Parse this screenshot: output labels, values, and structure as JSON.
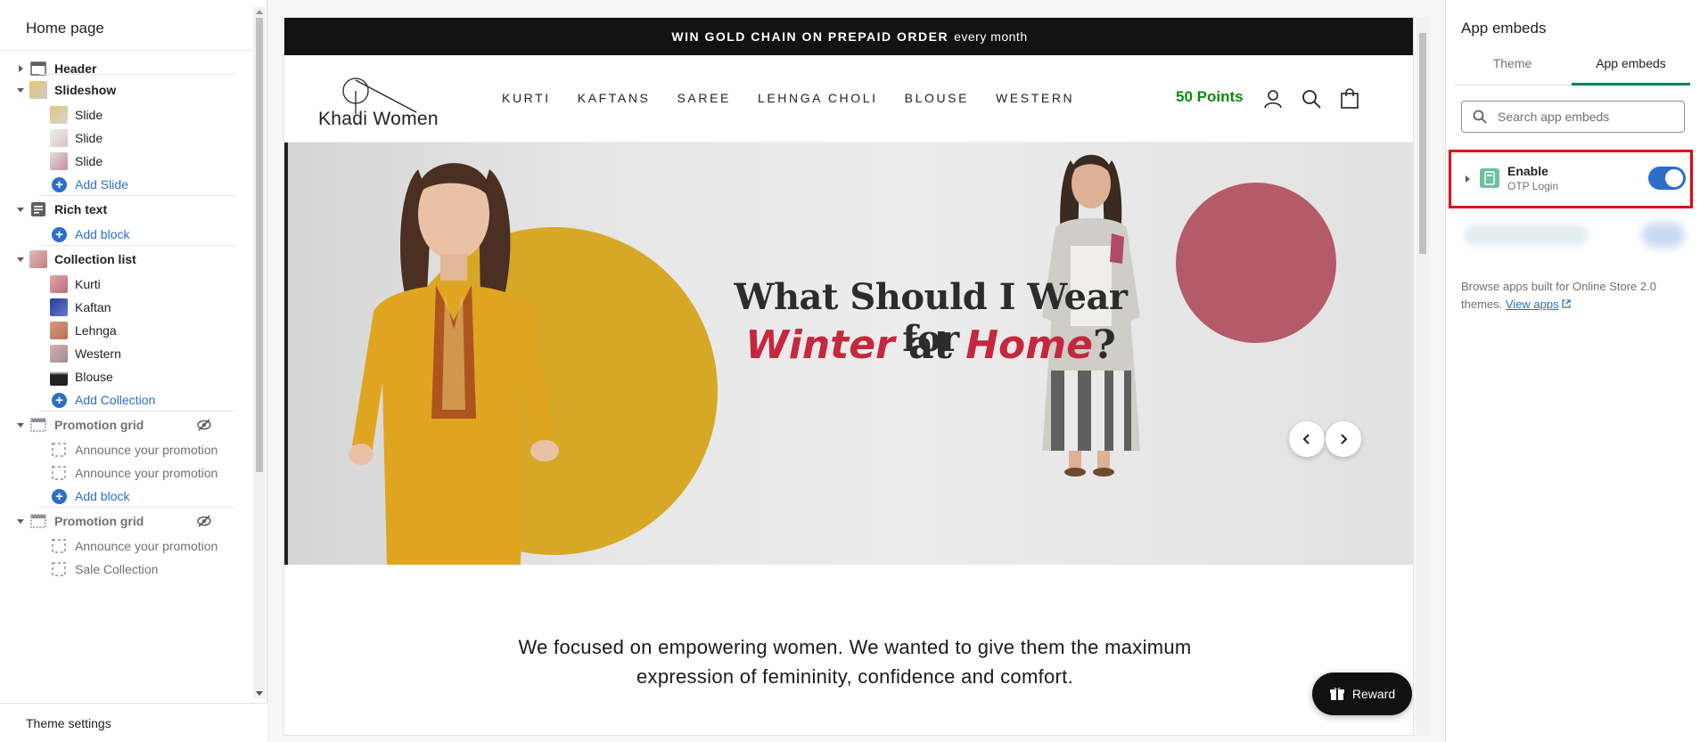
{
  "left_panel": {
    "title": "Home page",
    "sections": [
      {
        "label": "Header"
      },
      {
        "label": "Slideshow",
        "children": [
          "Slide",
          "Slide",
          "Slide"
        ],
        "add_label": "Add Slide"
      },
      {
        "label": "Rich text",
        "add_label": "Add block"
      },
      {
        "label": "Collection list",
        "children": [
          "Kurti",
          "Kaftan",
          "Lehnga",
          "Western",
          "Blouse"
        ],
        "add_label": "Add Collection"
      },
      {
        "label": "Promotion grid",
        "hidden": true,
        "children": [
          "Announce your promotion",
          "Announce your promotion"
        ],
        "add_label": "Add block"
      },
      {
        "label": "Promotion grid",
        "hidden": true,
        "children": [
          "Announce your promotion",
          "Sale Collection"
        ]
      }
    ],
    "footer_label": "Theme settings"
  },
  "preview": {
    "announcement_bold": "WIN GOLD CHAIN ON PREPAID ORDER",
    "announcement_rest": "every month",
    "logo_text": "Khadi Women",
    "nav": [
      "KURTI",
      "KAFTANS",
      "SAREE",
      "LEHNGA CHOLI",
      "BLOUSE",
      "WESTERN"
    ],
    "points": "50 Points",
    "hero_line1": "What Should I Wear for",
    "hero_word1": "Winter",
    "hero_mid": "at",
    "hero_word2": "Home",
    "hero_end": "?",
    "tagline_line1": "We focused on empowering women. We wanted to give them the maximum",
    "tagline_line2": "expression of femininity, confidence and comfort.",
    "reward_label": "Reward"
  },
  "right_panel": {
    "title": "App embeds",
    "tabs": [
      "Theme",
      "App embeds"
    ],
    "active_tab": "App embeds",
    "search_placeholder": "Search app embeds",
    "embed": {
      "name": "Enable",
      "app": "OTP Login",
      "enabled": true
    },
    "browse_text": "Browse apps built for Online Store 2.0 themes.",
    "view_apps": "View apps"
  },
  "colors": {
    "accent_blue": "#2c6ecb",
    "tab_underline": "#008060",
    "points_green": "#0b8a0b",
    "highlight_red": "#e3000f",
    "hero_yellow": "#d7a726",
    "hero_red_text": "#c5283d"
  }
}
